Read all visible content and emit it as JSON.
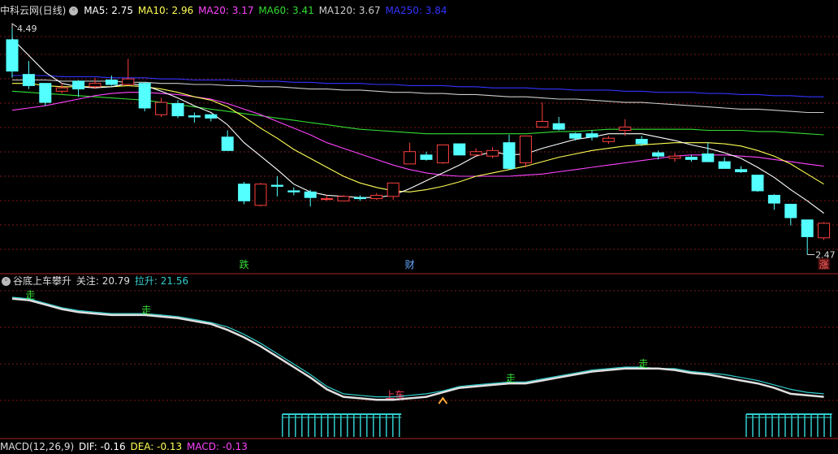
{
  "colors": {
    "up": "#ff4040",
    "down": "#54ffff",
    "ma5": "#ffffff",
    "ma10": "#ffff55",
    "ma20": "#ff44ff",
    "ma60": "#33dd33",
    "ma120": "#cccccc",
    "ma250": "#3333ff",
    "grid": "#7a1a1a",
    "divider": "#aa2222"
  },
  "main_legend": {
    "title": "中科云网(日线)",
    "ma5": "MA5: 2.75",
    "ma10": "MA10: 2.96",
    "ma20": "MA20: 3.17",
    "ma60": "MA60: 3.41",
    "ma120": "MA120: 3.67",
    "ma250": "MA250: 3.84"
  },
  "indicator_legend": {
    "name": "谷底上车攀升",
    "focus": "关注: 20.79",
    "rise": "拉升: 21.56"
  },
  "macd_legend": {
    "name": "MACD(12,26,9)",
    "dif": "DIF: -0.16",
    "dea": "DEA: -0.13",
    "macd": "MACD: -0.13"
  },
  "chart_data": [
    {
      "type": "candlestick",
      "title": "中科云网(日线)",
      "ylim": [
        2.35,
        4.6
      ],
      "high_marker": "4.49",
      "low_marker": "2.47",
      "candles": [
        [
          4.39,
          4.11,
          4.49,
          4.05
        ],
        [
          4.08,
          3.98,
          4.2,
          3.95
        ],
        [
          4.0,
          3.83,
          4.0,
          3.8
        ],
        [
          3.93,
          3.96,
          4.0,
          3.91
        ],
        [
          4.02,
          3.95,
          4.03,
          3.88
        ],
        [
          3.97,
          4.0,
          4.05,
          3.95
        ],
        [
          4.03,
          3.99,
          4.07,
          3.98
        ],
        [
          3.99,
          4.04,
          4.22,
          3.98
        ],
        [
          4.0,
          3.78,
          4.01,
          3.75
        ],
        [
          3.72,
          3.83,
          3.87,
          3.7
        ],
        [
          3.82,
          3.71,
          3.85,
          3.69
        ],
        [
          3.71,
          3.7,
          3.74,
          3.65
        ],
        [
          3.72,
          3.69,
          3.72,
          3.66
        ],
        [
          3.52,
          3.4,
          3.58,
          3.4
        ],
        [
          3.1,
          2.95,
          3.12,
          2.92
        ],
        [
          2.91,
          3.1,
          3.11,
          2.9
        ],
        [
          3.09,
          3.08,
          3.17,
          2.99
        ],
        [
          3.04,
          3.03,
          3.07,
          3.0
        ],
        [
          3.03,
          2.98,
          3.05,
          2.9
        ],
        [
          2.97,
          2.97,
          3.0,
          2.95
        ],
        [
          2.95,
          2.99,
          3.0,
          2.95
        ],
        [
          2.98,
          2.97,
          3.0,
          2.95
        ],
        [
          2.97,
          3.0,
          3.02,
          2.96
        ],
        [
          2.99,
          3.11,
          3.11,
          2.96
        ],
        [
          3.28,
          3.39,
          3.47,
          3.28
        ],
        [
          3.36,
          3.32,
          3.39,
          3.31
        ],
        [
          3.29,
          3.45,
          3.45,
          3.28
        ],
        [
          3.46,
          3.36,
          3.46,
          3.36
        ],
        [
          3.36,
          3.39,
          3.42,
          3.35
        ],
        [
          3.35,
          3.4,
          3.43,
          3.33
        ],
        [
          3.47,
          3.24,
          3.54,
          3.23
        ],
        [
          3.29,
          3.53,
          3.53,
          3.25
        ],
        [
          3.61,
          3.66,
          3.83,
          3.61
        ],
        [
          3.64,
          3.59,
          3.7,
          3.58
        ],
        [
          3.55,
          3.51,
          3.56,
          3.49
        ],
        [
          3.55,
          3.52,
          3.58,
          3.49
        ],
        [
          3.48,
          3.51,
          3.53,
          3.46
        ],
        [
          3.58,
          3.61,
          3.68,
          3.53
        ],
        [
          3.5,
          3.46,
          3.53,
          3.44
        ],
        [
          3.38,
          3.35,
          3.4,
          3.32
        ],
        [
          3.33,
          3.35,
          3.38,
          3.3
        ],
        [
          3.34,
          3.32,
          3.36,
          3.3
        ],
        [
          3.37,
          3.3,
          3.47,
          3.3
        ],
        [
          3.3,
          3.24,
          3.34,
          3.24
        ],
        [
          3.23,
          3.21,
          3.26,
          3.2
        ],
        [
          3.18,
          3.04,
          3.18,
          3.03
        ],
        [
          3.0,
          2.93,
          3.01,
          2.87
        ],
        [
          2.92,
          2.8,
          2.92,
          2.73
        ],
        [
          2.78,
          2.63,
          2.78,
          2.47
        ],
        [
          2.62,
          2.75,
          2.76,
          2.6
        ]
      ],
      "ma": {
        "MA5": [
          4.4,
          4.25,
          4.1,
          4.0,
          3.97,
          3.96,
          3.97,
          4.0,
          3.98,
          3.93,
          3.87,
          3.8,
          3.74,
          3.63,
          3.47,
          3.35,
          3.23,
          3.1,
          3.03,
          3.0,
          2.99,
          2.98,
          2.98,
          3.0,
          3.06,
          3.13,
          3.2,
          3.27,
          3.35,
          3.39,
          3.36,
          3.37,
          3.42,
          3.46,
          3.5,
          3.52,
          3.55,
          3.55,
          3.55,
          3.52,
          3.49,
          3.45,
          3.42,
          3.38,
          3.33,
          3.25,
          3.16,
          3.05,
          2.95,
          2.84
        ],
        "MA10": [
          4.0,
          4.0,
          3.98,
          3.97,
          3.97,
          3.97,
          3.97,
          3.98,
          3.97,
          3.95,
          3.92,
          3.88,
          3.85,
          3.79,
          3.7,
          3.6,
          3.51,
          3.41,
          3.33,
          3.25,
          3.17,
          3.11,
          3.07,
          3.04,
          3.03,
          3.05,
          3.08,
          3.12,
          3.17,
          3.2,
          3.23,
          3.26,
          3.3,
          3.34,
          3.37,
          3.4,
          3.42,
          3.44,
          3.45,
          3.46,
          3.47,
          3.47,
          3.47,
          3.46,
          3.44,
          3.4,
          3.35,
          3.28,
          3.19,
          3.1
        ],
        "MA20": [
          3.76,
          3.78,
          3.8,
          3.83,
          3.86,
          3.89,
          3.91,
          3.92,
          3.92,
          3.91,
          3.9,
          3.88,
          3.86,
          3.82,
          3.77,
          3.72,
          3.66,
          3.6,
          3.54,
          3.47,
          3.42,
          3.37,
          3.32,
          3.27,
          3.23,
          3.2,
          3.18,
          3.17,
          3.17,
          3.17,
          3.17,
          3.18,
          3.19,
          3.21,
          3.23,
          3.25,
          3.27,
          3.29,
          3.31,
          3.33,
          3.35,
          3.36,
          3.36,
          3.36,
          3.35,
          3.34,
          3.32,
          3.3,
          3.28,
          3.26
        ],
        "MA60": [
          3.93,
          3.92,
          3.91,
          3.9,
          3.89,
          3.88,
          3.87,
          3.86,
          3.85,
          3.83,
          3.81,
          3.79,
          3.77,
          3.75,
          3.73,
          3.71,
          3.69,
          3.67,
          3.65,
          3.63,
          3.61,
          3.59,
          3.58,
          3.57,
          3.56,
          3.55,
          3.55,
          3.55,
          3.55,
          3.55,
          3.55,
          3.55,
          3.56,
          3.57,
          3.57,
          3.58,
          3.59,
          3.59,
          3.59,
          3.59,
          3.59,
          3.59,
          3.58,
          3.58,
          3.58,
          3.57,
          3.57,
          3.56,
          3.55,
          3.54
        ],
        "MA120": [
          4.03,
          4.03,
          4.03,
          4.02,
          4.02,
          4.02,
          4.02,
          4.01,
          4.01,
          4.0,
          4.0,
          3.99,
          3.99,
          3.98,
          3.98,
          3.97,
          3.97,
          3.96,
          3.95,
          3.95,
          3.94,
          3.94,
          3.93,
          3.92,
          3.92,
          3.91,
          3.91,
          3.9,
          3.9,
          3.89,
          3.88,
          3.88,
          3.87,
          3.86,
          3.86,
          3.85,
          3.84,
          3.83,
          3.83,
          3.82,
          3.81,
          3.8,
          3.79,
          3.78,
          3.77,
          3.77,
          3.76,
          3.75,
          3.74,
          3.74
        ],
        "MA250": [
          4.07,
          4.07,
          4.07,
          4.06,
          4.06,
          4.06,
          4.05,
          4.05,
          4.05,
          4.04,
          4.04,
          4.03,
          4.03,
          4.03,
          4.02,
          4.02,
          4.02,
          4.01,
          4.01,
          4.0,
          4.0,
          4.0,
          3.99,
          3.99,
          3.98,
          3.98,
          3.98,
          3.97,
          3.97,
          3.96,
          3.96,
          3.96,
          3.95,
          3.95,
          3.94,
          3.94,
          3.94,
          3.93,
          3.93,
          3.92,
          3.92,
          3.92,
          3.91,
          3.91,
          3.9,
          3.9,
          3.89,
          3.89,
          3.88,
          3.88
        ]
      },
      "marks": [
        {
          "index": 14,
          "label": "跌",
          "color": "#33dd33"
        },
        {
          "index": 24,
          "label": "财",
          "color": "#66aaff"
        },
        {
          "index": 49,
          "label": "涨",
          "color": "#ff6666"
        }
      ]
    },
    {
      "type": "line",
      "title": "谷底上车攀升",
      "ylim": [
        0,
        100
      ],
      "series": [
        {
          "name": "关注",
          "color": "#e0e0e0",
          "values": [
            93,
            92,
            89,
            86,
            84,
            83,
            82,
            82,
            82,
            81,
            80,
            78,
            76,
            72,
            67,
            61,
            54,
            47,
            40,
            32,
            27,
            26,
            25,
            25,
            26,
            27,
            30,
            33,
            34,
            35,
            36,
            36,
            38,
            40,
            42,
            44,
            45,
            46,
            46,
            46,
            45,
            43,
            42,
            40,
            38,
            36,
            33,
            29,
            28,
            27
          ]
        },
        {
          "name": "拉升",
          "color": "#33cccc",
          "values": [
            94,
            93,
            90,
            87,
            85,
            84,
            83,
            83,
            83,
            82,
            81,
            79,
            77,
            74,
            69,
            63,
            56,
            49,
            42,
            34,
            29,
            28,
            27,
            27,
            28,
            29,
            31,
            34,
            35,
            36,
            37,
            37,
            39,
            41,
            43,
            45,
            46,
            47,
            47,
            46,
            46,
            44,
            43,
            42,
            40,
            38,
            35,
            32,
            30,
            29
          ]
        }
      ],
      "marks": [
        {
          "index": 1,
          "label": "走",
          "color": "#33dd33"
        },
        {
          "index": 8,
          "label": "走",
          "color": "#33dd33"
        },
        {
          "index": 23,
          "label": "上车",
          "color": "#ff4466"
        },
        {
          "index": 30,
          "label": "走",
          "color": "#33dd33"
        },
        {
          "index": 38,
          "label": "走",
          "color": "#33dd33"
        }
      ],
      "zones": [
        [
          17,
          23
        ],
        [
          45,
          49
        ]
      ]
    }
  ]
}
